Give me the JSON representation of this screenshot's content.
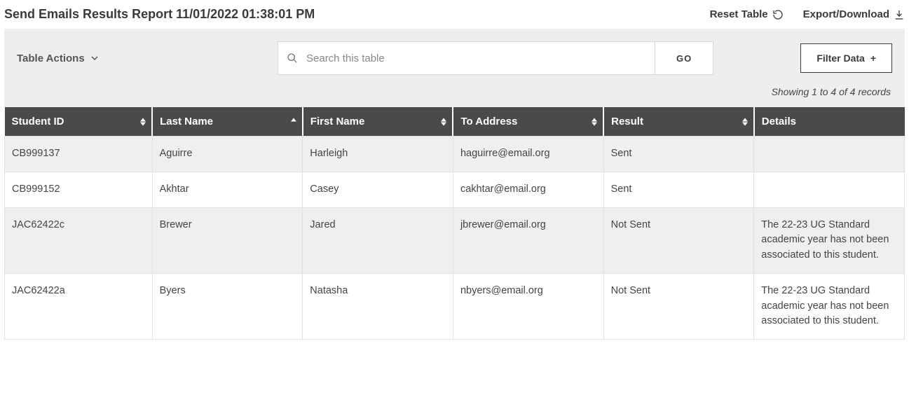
{
  "header": {
    "title": "Send Emails Results Report 11/01/2022 01:38:01 PM",
    "reset_label": "Reset Table",
    "export_label": "Export/Download"
  },
  "toolbar": {
    "table_actions_label": "Table Actions",
    "search_placeholder": "Search this table",
    "go_label": "GO",
    "filter_label": "Filter Data",
    "record_count_text": "Showing 1 to 4 of 4 records"
  },
  "table": {
    "columns": [
      {
        "label": "Student ID",
        "sort": "both"
      },
      {
        "label": "Last Name",
        "sort": "asc"
      },
      {
        "label": "First Name",
        "sort": "both"
      },
      {
        "label": "To Address",
        "sort": "both"
      },
      {
        "label": "Result",
        "sort": "both"
      },
      {
        "label": "Details",
        "sort": "none"
      }
    ],
    "rows": [
      {
        "student_id": "CB999137",
        "last_name": "Aguirre",
        "first_name": "Harleigh",
        "to_address": "haguirre@email.org",
        "result": "Sent",
        "details": ""
      },
      {
        "student_id": "CB999152",
        "last_name": "Akhtar",
        "first_name": "Casey",
        "to_address": "cakhtar@email.org",
        "result": "Sent",
        "details": ""
      },
      {
        "student_id": "JAC62422c",
        "last_name": "Brewer",
        "first_name": "Jared",
        "to_address": "jbrewer@email.org",
        "result": "Not Sent",
        "details": "The 22-23 UG Standard academic year has not been associated to this student."
      },
      {
        "student_id": "JAC62422a",
        "last_name": "Byers",
        "first_name": "Natasha",
        "to_address": "nbyers@email.org",
        "result": "Not Sent",
        "details": "The 22-23 UG Standard academic year has not been associated to this student."
      }
    ]
  }
}
